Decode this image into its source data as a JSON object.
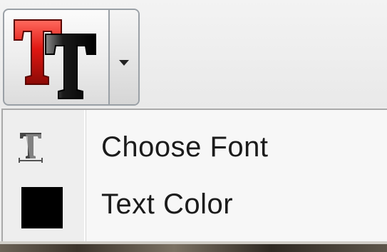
{
  "toolbar": {
    "text_style_button": {
      "icon": "text-style-tt-icon",
      "dropdown_icon": "chevron-down-icon"
    }
  },
  "menu": {
    "items": [
      {
        "label": "Choose Font",
        "icon": "font-icon"
      },
      {
        "label": "Text Color",
        "icon": "color-swatch-icon",
        "color": "#000000"
      }
    ]
  },
  "colors": {
    "accent_red": "#e0211c",
    "text_black": "#1b1b1b"
  }
}
